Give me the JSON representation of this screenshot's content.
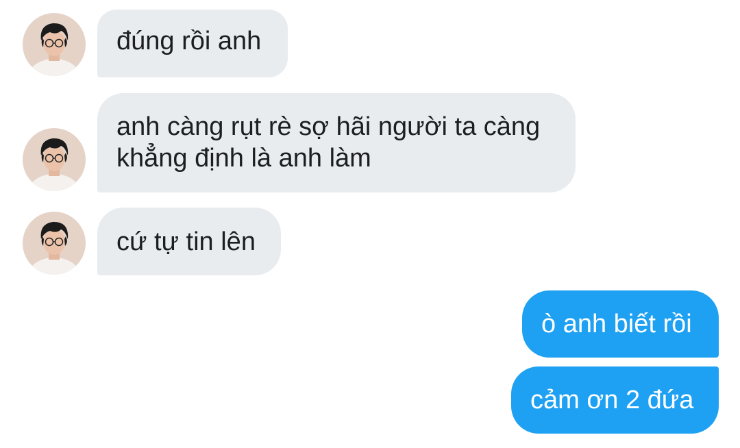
{
  "conversation": {
    "incoming": [
      {
        "text": "đúng rồi anh"
      },
      {
        "line1": "anh càng rụt rè sợ hãi người ta càng",
        "line2": "khẳng định là anh làm"
      },
      {
        "text": "cứ tự tin lên"
      }
    ],
    "outgoing": [
      {
        "text": "ò anh biết rồi"
      },
      {
        "text": "cảm ơn 2 đứa"
      }
    ],
    "colors": {
      "incoming_bubble": "#e9ecef",
      "outgoing_bubble": "#1ea1f2",
      "incoming_text": "#1c1e21",
      "outgoing_text": "#ffffff"
    },
    "avatar_icon": "person-photo-avatar"
  }
}
